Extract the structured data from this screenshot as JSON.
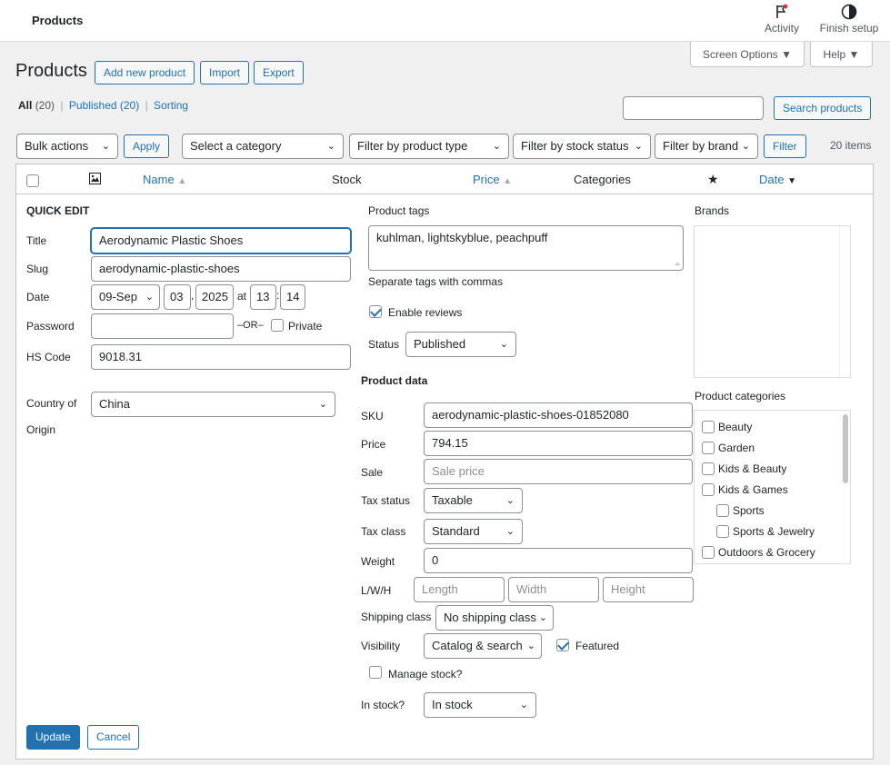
{
  "topbar": {
    "title": "Products",
    "activity": "Activity",
    "finish_setup": "Finish setup"
  },
  "screen_options": "Screen Options ▼",
  "help": "Help ▼",
  "heading": "Products",
  "actions": {
    "add_new": "Add new product",
    "import": "Import",
    "export": "Export"
  },
  "views": {
    "all": "All",
    "all_count": "(20)",
    "published": "Published (20)",
    "sorting": "Sorting",
    "sep": "|"
  },
  "search": {
    "value": "",
    "button": "Search products"
  },
  "filters": {
    "bulk": "Bulk actions",
    "apply": "Apply",
    "category": "Select a category",
    "type": "Filter by product type",
    "stock": "Filter by stock status",
    "brand": "Filter by brand",
    "filter": "Filter",
    "count": "20 items"
  },
  "columns": {
    "name": "Name",
    "stock": "Stock",
    "price": "Price",
    "categories": "Categories",
    "date": "Date"
  },
  "quick_edit": {
    "heading": "QUICK EDIT",
    "title_label": "Title",
    "title_value": "Aerodynamic Plastic Shoes",
    "slug_label": "Slug",
    "slug_value": "aerodynamic-plastic-shoes",
    "date_label": "Date",
    "month": "09-Sep",
    "day": "03",
    "year": "2025",
    "at": "at",
    "hour": "13",
    "minute": "14",
    "comma": ",",
    "colon": ":",
    "password_label": "Password",
    "or": "–OR–",
    "private": "Private",
    "hs_label": "HS Code",
    "hs_value": "9018.31",
    "country_label_1": "Country of",
    "country_label_2": "Origin",
    "country_value": "China",
    "tags_label": "Product tags",
    "tags_value": "kuhlman, lightskyblue, peachpuff",
    "tags_hint": "Separate tags with commas",
    "enable_reviews": "Enable reviews",
    "status_label": "Status",
    "status_value": "Published",
    "product_data": "Product data",
    "sku_label": "SKU",
    "sku_value": "aerodynamic-plastic-shoes-01852080",
    "price_label": "Price",
    "price_value": "794.15",
    "sale_label": "Sale",
    "sale_placeholder": "Sale price",
    "tax_status_label": "Tax status",
    "tax_status_value": "Taxable",
    "tax_class_label": "Tax class",
    "tax_class_value": "Standard",
    "weight_label": "Weight",
    "weight_value": "0",
    "lwh_label": "L/W/H",
    "length_ph": "Length",
    "width_ph": "Width",
    "height_ph": "Height",
    "shipping_label": "Shipping class",
    "shipping_value": "No shipping class",
    "visibility_label": "Visibility",
    "visibility_value": "Catalog & search",
    "featured": "Featured",
    "manage_stock": "Manage stock?",
    "in_stock_label": "In stock?",
    "in_stock_value": "In stock",
    "brands_label": "Brands",
    "categories_label": "Product categories",
    "categories": [
      {
        "label": "Beauty",
        "child": false
      },
      {
        "label": "Garden",
        "child": false
      },
      {
        "label": "Kids & Beauty",
        "child": false
      },
      {
        "label": "Kids & Games",
        "child": false
      },
      {
        "label": "Sports",
        "child": true
      },
      {
        "label": "Sports & Jewelry",
        "child": true
      },
      {
        "label": "Outdoors & Grocery",
        "child": false
      }
    ],
    "update": "Update",
    "cancel": "Cancel"
  }
}
